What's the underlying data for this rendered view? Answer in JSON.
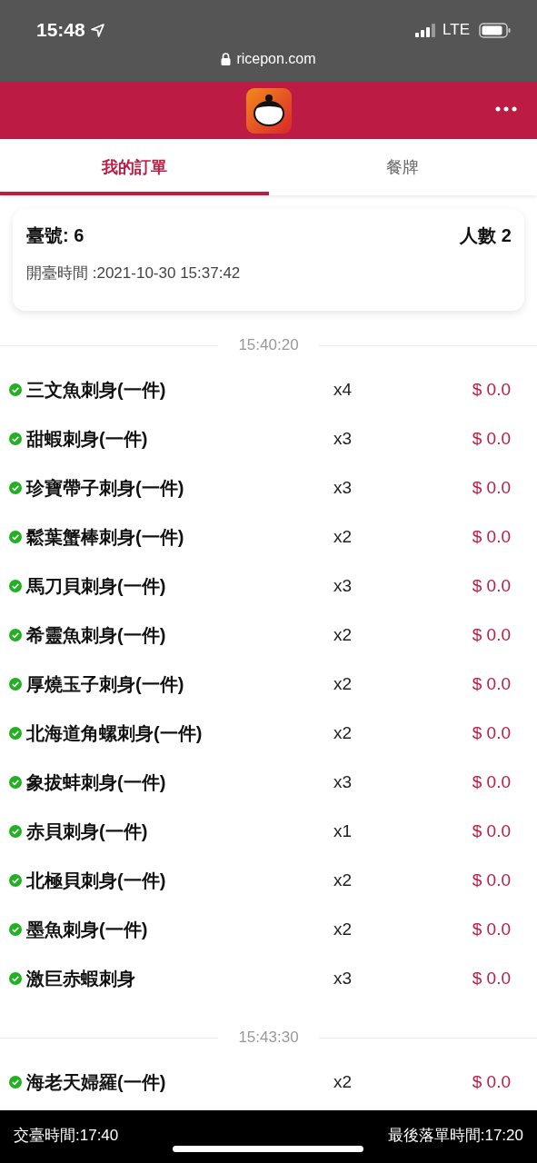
{
  "status_bar": {
    "time": "15:48",
    "network": "LTE",
    "url": "ricepon.com"
  },
  "tabs": [
    {
      "label": "我的訂單",
      "selected": true
    },
    {
      "label": "餐牌",
      "selected": false
    }
  ],
  "table_card": {
    "table_label": "臺號:",
    "table_number": "6",
    "guests_label": "人數",
    "guests": "2",
    "open_time": "開臺時間 :2021-10-30 15:37:42"
  },
  "order_groups": [
    {
      "time": "15:40:20",
      "items": [
        {
          "name": "三文魚刺身(一件)",
          "qty": "x4",
          "price": "$ 0.0",
          "confirmed": true
        },
        {
          "name": "甜蝦刺身(一件)",
          "qty": "x3",
          "price": "$ 0.0",
          "confirmed": true
        },
        {
          "name": "珍寶帶子刺身(一件)",
          "qty": "x3",
          "price": "$ 0.0",
          "confirmed": true
        },
        {
          "name": "鬆葉蟹棒刺身(一件)",
          "qty": "x2",
          "price": "$ 0.0",
          "confirmed": true
        },
        {
          "name": "馬刀貝刺身(一件)",
          "qty": "x3",
          "price": "$ 0.0",
          "confirmed": true
        },
        {
          "name": "希靈魚刺身(一件)",
          "qty": "x2",
          "price": "$ 0.0",
          "confirmed": true
        },
        {
          "name": "厚燒玉子刺身(一件)",
          "qty": "x2",
          "price": "$ 0.0",
          "confirmed": true
        },
        {
          "name": "北海道角螺刺身(一件)",
          "qty": "x2",
          "price": "$ 0.0",
          "confirmed": true
        },
        {
          "name": "象拔蚌刺身(一件)",
          "qty": "x3",
          "price": "$ 0.0",
          "confirmed": true
        },
        {
          "name": "赤貝刺身(一件)",
          "qty": "x1",
          "price": "$ 0.0",
          "confirmed": true
        },
        {
          "name": "北極貝刺身(一件)",
          "qty": "x2",
          "price": "$ 0.0",
          "confirmed": true
        },
        {
          "name": "墨魚刺身(一件)",
          "qty": "x2",
          "price": "$ 0.0",
          "confirmed": true
        },
        {
          "name": "激巨赤蝦刺身",
          "qty": "x3",
          "price": "$ 0.0",
          "confirmed": true
        }
      ]
    },
    {
      "time": "15:43:30",
      "items": [
        {
          "name": "海老天婦羅(一件)",
          "qty": "x2",
          "price": "$ 0.0",
          "confirmed": true
        }
      ]
    }
  ],
  "footer": {
    "close_time": "交臺時間:17:40",
    "last_order_time": "最後落單時間:17:20"
  }
}
